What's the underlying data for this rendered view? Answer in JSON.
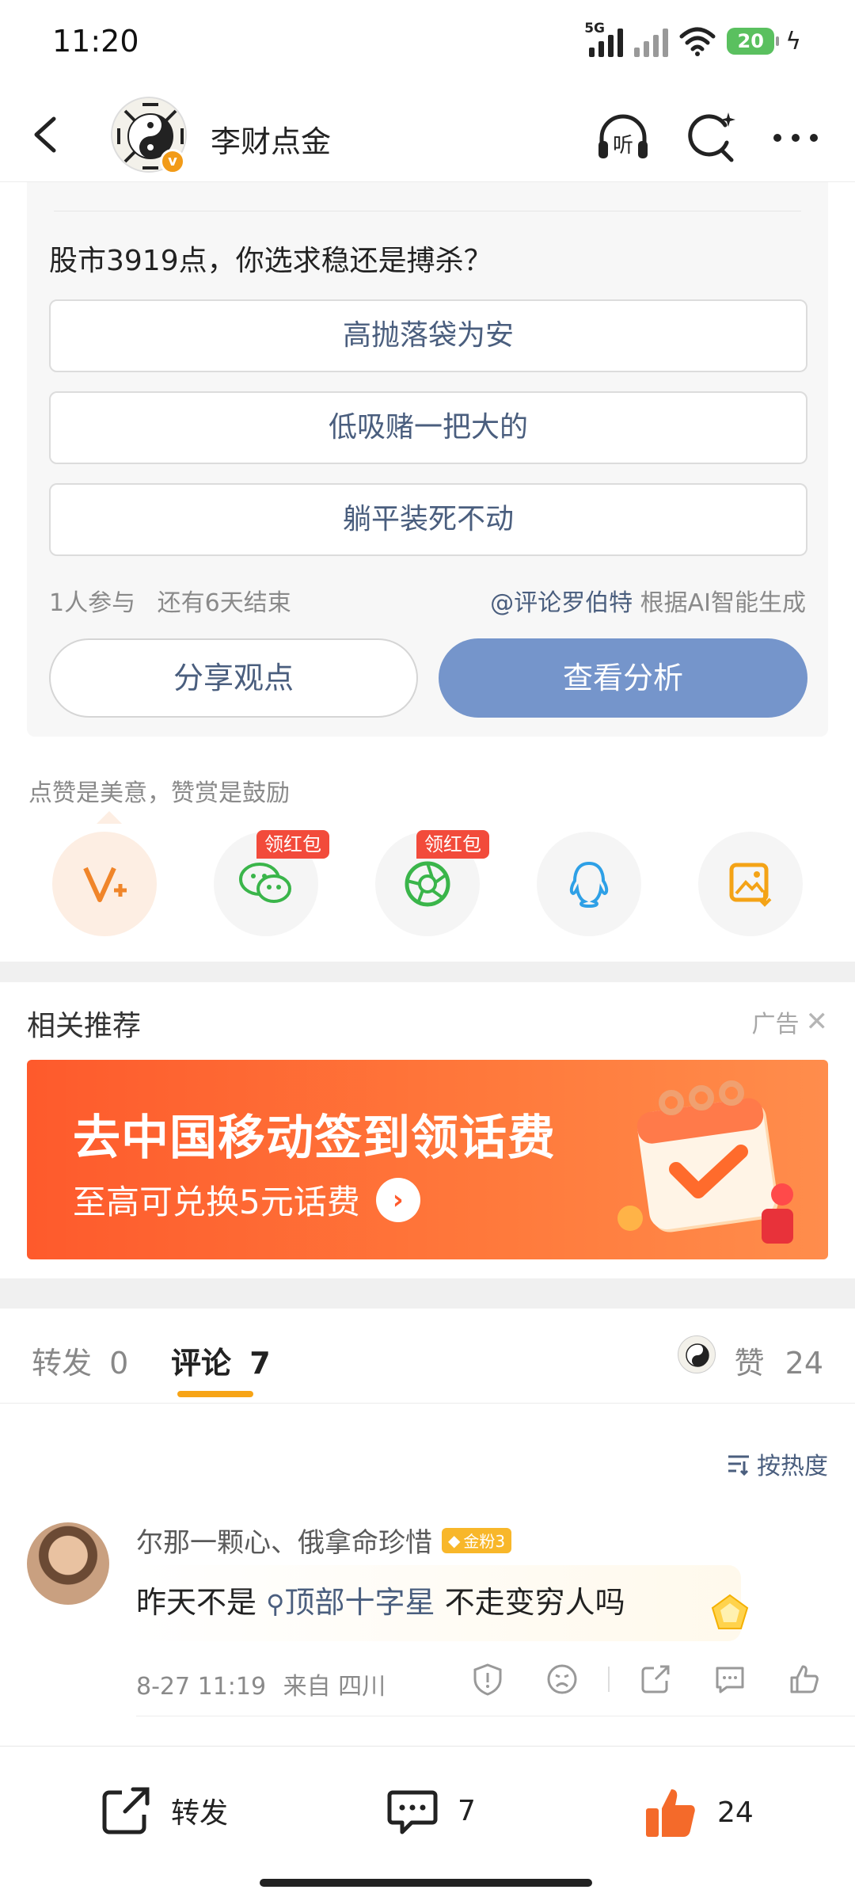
{
  "status_bar": {
    "time": "11:20",
    "network": "5G",
    "battery": "20"
  },
  "header": {
    "title": "李财点金",
    "back_icon": "chevron-left-icon",
    "listen_icon": "headphones-listen-icon",
    "listen_label": "听",
    "search_icon": "search-sparkle-icon",
    "more_icon": "more-dots-icon"
  },
  "poll": {
    "question": "股市3919点，你选求稳还是搏杀？",
    "options": [
      "高抛落袋为安",
      "低吸赌一把大的",
      "躺平装死不动"
    ],
    "participants": "1人参与",
    "time_left": "还有6天结束",
    "ai_mention": "@评论罗伯特",
    "ai_note": "根据AI智能生成",
    "share_label": "分享观点",
    "analysis_label": "查看分析"
  },
  "reward": {
    "hint": "点赞是美意，赞赏是鼓励",
    "badge_label": "领红包",
    "actions": [
      {
        "icon": "v-plus-reward-icon"
      },
      {
        "icon": "wechat-icon",
        "badge": "领红包"
      },
      {
        "icon": "moments-icon",
        "badge": "领红包"
      },
      {
        "icon": "qq-icon"
      },
      {
        "icon": "save-image-icon"
      }
    ]
  },
  "recommend": {
    "title": "相关推荐",
    "ad_label": "广告",
    "ad_headline": "去中国移动签到领话费",
    "ad_sub": "至高可兑换5元话费"
  },
  "tabs": {
    "repost_label": "转发",
    "repost_count": "0",
    "comment_label": "评论",
    "comment_count": "7",
    "like_label": "赞",
    "like_count": "24"
  },
  "sort_label": "按热度",
  "comments": [
    {
      "username": "尔那一颗心、俄拿命珍惜",
      "fan_badge": "金粉3",
      "text_before": "昨天不是",
      "topic": "顶部十字星",
      "text_after": " 不走变穷人吗",
      "date": "8-27 11:19",
      "location": "来自 四川"
    }
  ],
  "bottom_bar": {
    "repost_label": "转发",
    "comment_count": "7",
    "like_count": "24"
  },
  "colors": {
    "accent_orange": "#f7a416",
    "link_blue": "#4a5e7e",
    "analysis_button": "#7595cb",
    "red_badge": "#f24b3b",
    "ad_orange": "#fe5a2c",
    "like_orange": "#f46a2a"
  }
}
